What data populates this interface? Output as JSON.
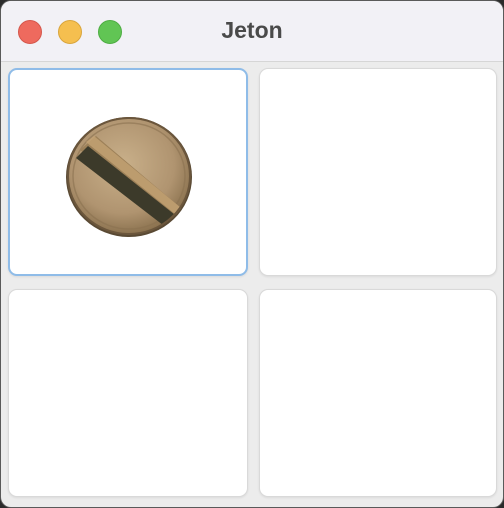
{
  "window": {
    "title": "Jeton"
  },
  "titlebar": {
    "buttons": [
      {
        "name": "close",
        "color": "#ee6a5e"
      },
      {
        "name": "minimize",
        "color": "#f5bf4f"
      },
      {
        "name": "zoom",
        "color": "#61c554"
      }
    ]
  },
  "grid": {
    "cells": [
      {
        "content": "token-image",
        "selected": true
      },
      {
        "content": "",
        "selected": false
      },
      {
        "content": "",
        "selected": false
      },
      {
        "content": "",
        "selected": false
      }
    ]
  },
  "colors": {
    "selection_border": "#8fbce8",
    "token_brass": "#b89c72",
    "token_slot": "#3e3a2a"
  }
}
